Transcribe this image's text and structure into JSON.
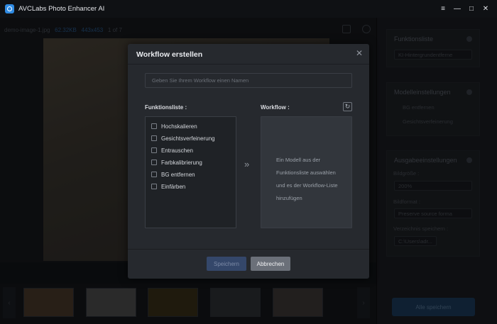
{
  "app": {
    "title": "AVCLabs Photo Enhancer AI",
    "minimize_label": "—",
    "maximize_label": "□",
    "close_label": "✕"
  },
  "workspace": {
    "filename": "demo-image-1.jpg",
    "filesize": "62.32KB",
    "dimensions": "443x453",
    "page": "1 of 7"
  },
  "sidebar": {
    "function_list_title": "Funktionsliste",
    "function_dropdown": "KI-Hintergrundentferne",
    "model_settings_title": "Modelleinstellungen",
    "model_option_1": "BG entfernen",
    "model_option_2": "Gesichtsverfeinerung",
    "output_settings_title": "Ausgabeeinstellungen",
    "image_size_label": "Bildgröße :",
    "image_size_value": "200%",
    "image_format_label": "Bildformat :",
    "image_format_value": "Preserve source forma",
    "save_dir_label": "Verzeichnis speichern :",
    "save_dir_value": "C:\\Users\\adr...",
    "save_all_label": "Alle speichern"
  },
  "dialog": {
    "title": "Workflow erstellen",
    "name_placeholder": "Geben Sie Ihrem Workflow einen Namen",
    "function_list_label": "Funktionsliste :",
    "workflow_label": "Workflow :",
    "functions": [
      {
        "label": "Hochskalieren",
        "checked": false
      },
      {
        "label": "Gesichtsverfeinerung",
        "checked": false
      },
      {
        "label": "Entrauschen",
        "checked": false
      },
      {
        "label": "Farbkalibrierung",
        "checked": false
      },
      {
        "label": "BG entfernen",
        "checked": false
      },
      {
        "label": "Einfärben",
        "checked": false
      }
    ],
    "workflow_hint_lines": [
      "Ein Modell aus der",
      "Funktionsliste auswählen",
      "und es der Workflow-Liste",
      "hinzufügen"
    ],
    "save_label": "Speichern",
    "cancel_label": "Abbrechen"
  }
}
